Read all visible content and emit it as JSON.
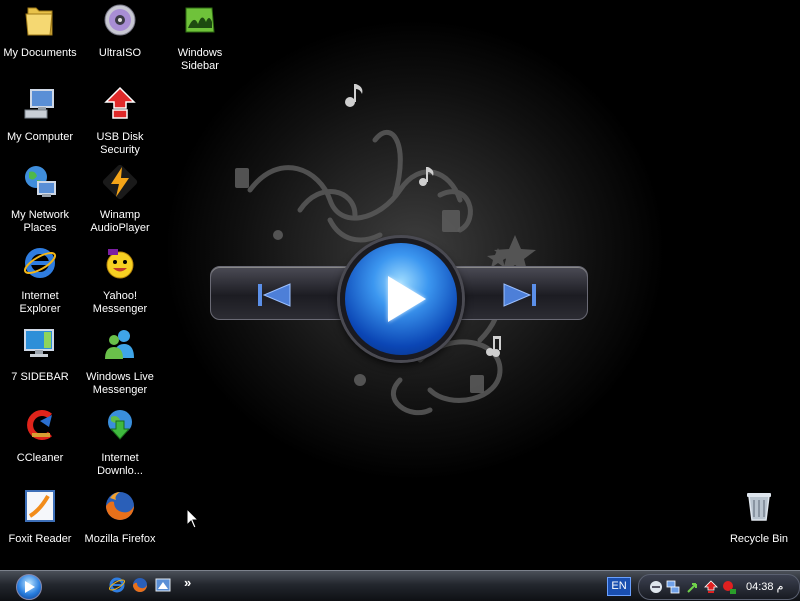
{
  "desktop": {
    "icons": [
      {
        "label": "My Documents"
      },
      {
        "label": "UltraISO"
      },
      {
        "label": "Windows Sidebar"
      },
      {
        "label": "My Computer"
      },
      {
        "label": "USB Disk Security"
      },
      {
        "label": "My Network Places"
      },
      {
        "label": "Winamp AudioPlayer"
      },
      {
        "label": "Internet Explorer"
      },
      {
        "label": "Yahoo! Messenger"
      },
      {
        "label": "7 SIDEBAR"
      },
      {
        "label": "Windows Live Messenger"
      },
      {
        "label": "CCleaner"
      },
      {
        "label": "Internet Downlo..."
      },
      {
        "label": "Foxit Reader"
      },
      {
        "label": "Mozilla Firefox"
      },
      {
        "label": "Recycle Bin"
      }
    ]
  },
  "taskbar": {
    "quicklaunch_more": "»",
    "language": "EN",
    "clock": "04:38 م"
  },
  "colors": {
    "accent_blue": "#2a7fe0",
    "taskbar_dark": "#23272e",
    "tray_red": "#e02020"
  }
}
